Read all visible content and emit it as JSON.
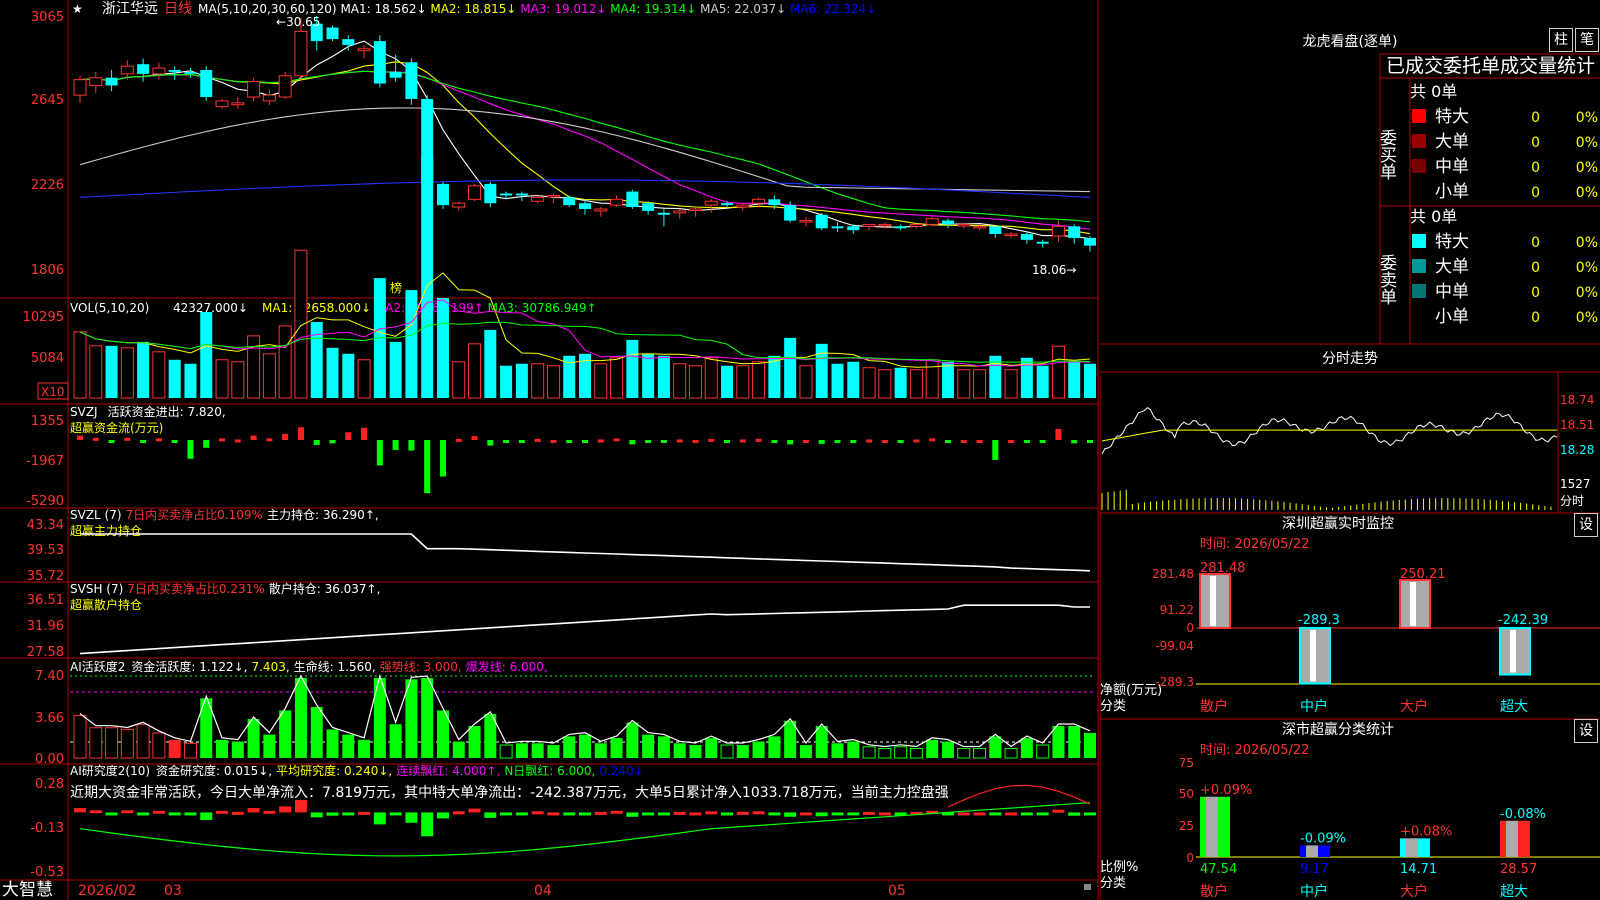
{
  "app": {
    "brand": "大智慧"
  },
  "header": {
    "star": "★",
    "stock_name": "浙江华远",
    "period": "日线",
    "ma_label": "MA(5,10,20,30,60,120)",
    "ma": [
      {
        "name": "MA1",
        "value": "18.562↓",
        "color": "#ffffff"
      },
      {
        "name": "MA2",
        "value": "18.815↓",
        "color": "#ffff00"
      },
      {
        "name": "MA3",
        "value": "19.012↓",
        "color": "#ff00ff"
      },
      {
        "name": "MA4",
        "value": "19.314↓",
        "color": "#00ff00"
      },
      {
        "name": "MA5",
        "value": "22.037↓",
        "color": "#cccccc"
      },
      {
        "name": "MA6",
        "value": "22.324↓",
        "color": "#0000ff"
      }
    ]
  },
  "price_panel": {
    "y_labels": [
      "3065",
      "2645",
      "2226",
      "1806"
    ],
    "high_mark": "30.65",
    "low_mark": "18.06",
    "bang_label": "榜",
    "candles": [
      [
        26.5,
        27.3,
        26.1,
        27.5
      ],
      [
        27,
        27.4,
        26.6,
        27.7
      ],
      [
        27.4,
        27,
        26.7,
        27.8
      ],
      [
        27.6,
        28,
        27.3,
        28.3
      ],
      [
        28.1,
        27.6,
        27.2,
        28.4
      ],
      [
        27.6,
        27.9,
        27.3,
        28.2
      ],
      [
        27.8,
        27.7,
        27.3,
        28
      ],
      [
        27.7,
        27.6,
        27.4,
        27.9
      ],
      [
        27.8,
        26.4,
        26.2,
        28
      ],
      [
        25.9,
        26.2,
        25.8,
        26.3
      ],
      [
        26,
        26.1,
        25.8,
        26.4
      ],
      [
        26.4,
        27.2,
        26.2,
        27.4
      ],
      [
        26.2,
        26.5,
        26,
        26.8
      ],
      [
        26.4,
        27.5,
        26.3,
        27.7
      ],
      [
        27.5,
        29.8,
        27.3,
        30.5
      ],
      [
        30.2,
        29.3,
        28.8,
        30.6
      ],
      [
        30,
        29.4,
        29.3,
        30.1
      ],
      [
        29.4,
        29.1,
        28.8,
        29.6
      ],
      [
        28.8,
        28.9,
        28.4,
        29.1
      ],
      [
        29.3,
        27.1,
        26.9,
        29.6
      ],
      [
        27.7,
        27.4,
        27.2,
        28.6
      ],
      [
        28.2,
        26.3,
        26,
        28.4
      ],
      [
        26.3,
        21.9,
        21.7,
        26.5
      ],
      [
        21.9,
        20.8,
        20.6,
        22
      ],
      [
        20.7,
        20.9,
        20.5,
        21
      ],
      [
        21.1,
        21.8,
        21,
        21.9
      ],
      [
        21.9,
        20.9,
        20.7,
        22
      ],
      [
        21.4,
        21.3,
        21.1,
        21.5
      ],
      [
        21.4,
        21.3,
        21,
        21.5
      ],
      [
        21,
        21.2,
        20.9,
        21.3
      ],
      [
        21.3,
        21.3,
        20.9,
        21.4
      ],
      [
        21.2,
        20.8,
        20.7,
        21.3
      ],
      [
        20.9,
        20.6,
        20.3,
        21.1
      ],
      [
        20.5,
        20.6,
        20.2,
        20.7
      ],
      [
        20.8,
        21.1,
        20.7,
        21.3
      ],
      [
        21.5,
        20.7,
        20.6,
        21.6
      ],
      [
        20.9,
        20.5,
        20.3,
        21
      ],
      [
        20.4,
        20.3,
        19.7,
        20.6
      ],
      [
        20.4,
        20.5,
        20.1,
        20.6
      ],
      [
        20.6,
        20.6,
        20.2,
        20.7
      ],
      [
        20.8,
        21,
        20.4,
        21.1
      ],
      [
        20.9,
        20.8,
        20.6,
        21
      ],
      [
        20.7,
        20.8,
        20.5,
        20.9
      ],
      [
        20.9,
        21.1,
        20.7,
        21.2
      ],
      [
        21.1,
        20.8,
        20.6,
        21.3
      ],
      [
        20.8,
        20,
        19.9,
        21
      ],
      [
        20,
        20,
        19.7,
        20.2
      ],
      [
        20.3,
        19.6,
        19.5,
        20.4
      ],
      [
        19.7,
        19.6,
        19.4,
        19.9
      ],
      [
        19.7,
        19.5,
        19.3,
        19.8
      ],
      [
        19.7,
        19.8,
        19.5,
        19.8
      ],
      [
        19.8,
        19.8,
        19.6,
        19.9
      ],
      [
        19.7,
        19.6,
        19.5,
        19.8
      ],
      [
        19.7,
        19.8,
        19.6,
        19.8
      ],
      [
        19.8,
        20.1,
        19.7,
        20.2
      ],
      [
        20,
        19.8,
        19.6,
        20.1
      ],
      [
        19.8,
        19.8,
        19.6,
        19.9
      ],
      [
        19.7,
        19.7,
        19.5,
        19.8
      ],
      [
        19.7,
        19.3,
        19.1,
        19.7
      ],
      [
        19.3,
        19.3,
        19.1,
        19.4
      ],
      [
        19.3,
        19,
        18.8,
        19.4
      ],
      [
        18.9,
        18.8,
        18.6,
        19
      ],
      [
        19.2,
        19.7,
        18.9,
        20
      ],
      [
        19.7,
        19.1,
        18.8,
        19.8
      ],
      [
        19.1,
        18.7,
        18.4,
        19.2
      ]
    ]
  },
  "vol_panel": {
    "label": "VOL(5,10,20)",
    "vol_value": "42327.000↓",
    "ma": [
      {
        "name": "MA1",
        "value": "32658.000↓",
        "color": "#ffff00"
      },
      {
        "name": "MA2",
        "value": "29960.199↑",
        "color": "#ff00ff"
      },
      {
        "name": "MA3",
        "value": "30786.949↑",
        "color": "#00ff00"
      }
    ],
    "y_labels": [
      "10295",
      "5084"
    ],
    "unit": "X10"
  },
  "svzj_panel": {
    "label": "SVZJ",
    "item_name": "活跃资金进出",
    "item_value": "7.820",
    "sub_label": "超赢资金流(万元)",
    "y_labels": [
      "1355",
      "-1967",
      "-5290"
    ]
  },
  "svzl_panel": {
    "label": "SVZL (7)",
    "stat": "7日内买卖净占比0.109%",
    "main_label": "主力持仓",
    "main_value": "36.290↑,",
    "sub_label": "超赢主力持仓",
    "y_labels": [
      "43.34",
      "39.53",
      "35.72"
    ]
  },
  "svsh_panel": {
    "label": "SVSH (7)",
    "stat": "7日内买卖净占比0.231%",
    "main_label": "散户持仓",
    "main_value": "36.037↑,",
    "sub_label": "超赢散户持仓",
    "y_labels": [
      "36.51",
      "31.96",
      "27.58"
    ]
  },
  "ai1_panel": {
    "label": "AI活跃度2",
    "item1": "资金活跃度: 1.122↓,",
    "item2": "7.403,",
    "item3": "生命线: 1.560,",
    "item4": "强势线: 3.000,",
    "item5": "爆发线: 6.000,",
    "y_labels": [
      "7.40",
      "3.66",
      "0.00"
    ]
  },
  "ai2_panel": {
    "label": "AI研究度2(10)",
    "item1": "资金研究度: 0.015↓,",
    "item2": "平均研究度: 0.240↓,",
    "item3": "连续飘红: 4.000↑,",
    "item4": "N日飘红: 6.000,",
    "item5": "0.240↓",
    "comment": "近期大资金非常活跃，今日大单净流入：7.819万元，其中特大单净流出：-242.387万元，大单5日累计净入1033.718万元，当前主力控盘强",
    "y_labels": [
      "0.28",
      "-0.13",
      "-0.53"
    ]
  },
  "time_axis": [
    "2026/02",
    "03",
    "04",
    "05"
  ],
  "side": {
    "title": "龙虎看盘(逐单)",
    "btn1": "柱",
    "btn2": "笔",
    "table_header": "已成交委托单成交量统计",
    "buy": {
      "side_label": "委买单",
      "total": "共 0单",
      "rows": [
        {
          "name": "特大",
          "count": "0",
          "pct": "0%",
          "color": "#ff0000"
        },
        {
          "name": "大单",
          "count": "0",
          "pct": "0%",
          "color": "#990000"
        },
        {
          "name": "中单",
          "count": "0",
          "pct": "0%",
          "color": "#770000"
        },
        {
          "name": "小单",
          "count": "0",
          "pct": "0%",
          "color": ""
        }
      ]
    },
    "sell": {
      "side_label": "委卖单",
      "total": "共 0单",
      "rows": [
        {
          "name": "特大",
          "count": "0",
          "pct": "0%",
          "color": "#00ffff"
        },
        {
          "name": "大单",
          "count": "0",
          "pct": "0%",
          "color": "#009999"
        },
        {
          "name": "中单",
          "count": "0",
          "pct": "0%",
          "color": "#007777"
        },
        {
          "name": "小单",
          "count": "0",
          "pct": "0%",
          "color": ""
        }
      ]
    },
    "intraday": {
      "title": "分时走势",
      "y_labels": [
        "18.74",
        "18.51",
        "18.28"
      ],
      "vol_label": "1527",
      "vol_unit": "分时"
    },
    "monitor": {
      "title": "深圳超赢实时监控",
      "btn": "设",
      "time": "时间: 2026/05/22",
      "y_labels": [
        "281.48",
        "91.22",
        "0",
        "-99.04",
        "-289.3"
      ],
      "y_unit": "净额(万元)",
      "x_unit": "分类",
      "categories": [
        "散户",
        "中户",
        "大户",
        "超大"
      ],
      "values": [
        281.48,
        -289.3,
        250.21,
        -242.39
      ],
      "value_labels": [
        "281.48",
        "-289.3",
        "250.21",
        "-242.39"
      ]
    },
    "stats": {
      "title": "深市超赢分类统计",
      "btn": "设",
      "time": "时间: 2026/05/22",
      "y_labels": [
        "75",
        "50",
        "25",
        "0"
      ],
      "y_unit": "比例%",
      "x_unit": "分类",
      "categories": [
        "散户",
        "中户",
        "大户",
        "超大"
      ],
      "values": [
        47.54,
        9.17,
        14.71,
        28.57
      ],
      "value_labels": [
        "47.54",
        "9.17",
        "14.71",
        "28.57"
      ],
      "changes": [
        "+0.09%",
        "-0.09%",
        "+0.08%",
        "-0.08%"
      ]
    }
  }
}
